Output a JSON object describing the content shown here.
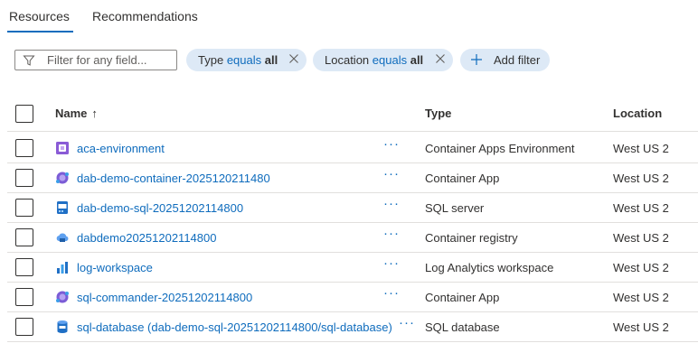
{
  "tabs": [
    {
      "label": "Resources",
      "active": true
    },
    {
      "label": "Recommendations",
      "active": false
    }
  ],
  "filter": {
    "placeholder": "Filter for any field..."
  },
  "pills": [
    {
      "field": "Type",
      "op": "equals",
      "value": "all"
    },
    {
      "field": "Location",
      "op": "equals",
      "value": "all"
    }
  ],
  "add_filter_label": "Add filter",
  "table": {
    "columns": {
      "name": "Name",
      "sort_indicator": "↑",
      "type": "Type",
      "location": "Location"
    },
    "more_label": "···",
    "rows": [
      {
        "name": "aca-environment",
        "type": "Container Apps Environment",
        "location": "West US 2",
        "icon": "container-apps-environment-icon"
      },
      {
        "name": "dab-demo-container-2025120211480",
        "type": "Container App",
        "location": "West US 2",
        "icon": "container-app-icon"
      },
      {
        "name": "dab-demo-sql-20251202114800",
        "type": "SQL server",
        "location": "West US 2",
        "icon": "sql-server-icon"
      },
      {
        "name": "dabdemo20251202114800",
        "type": "Container registry",
        "location": "West US 2",
        "icon": "container-registry-icon"
      },
      {
        "name": "log-workspace",
        "type": "Log Analytics workspace",
        "location": "West US 2",
        "icon": "log-analytics-icon"
      },
      {
        "name": "sql-commander-20251202114800",
        "type": "Container App",
        "location": "West US 2",
        "icon": "container-app-icon"
      },
      {
        "name": "sql-database (dab-demo-sql-20251202114800/sql-database)",
        "type": "SQL database",
        "location": "West US 2",
        "icon": "sql-database-icon"
      }
    ]
  },
  "colors": {
    "accent": "#0f6cbd",
    "pill_bg": "#dde9f6",
    "text": "#323130",
    "divider": "#e1dfdd"
  }
}
